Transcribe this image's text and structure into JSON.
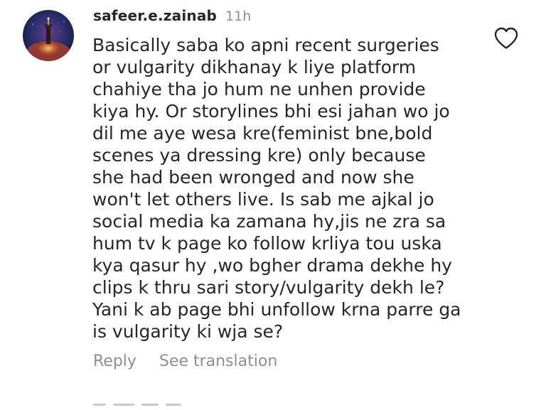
{
  "comment": {
    "username": "safeer.e.zainab",
    "timestamp": "11h",
    "avatar_icon": "profile-photo",
    "text_lines": [
      "Basically saba ko apni recent surgeries",
      "or vulgarity dikhanay k liye platform",
      "chahiye tha jo hum ne unhen provide",
      "kiya hy. Or storylines bhi esi jahan wo jo",
      "dil me aye wesa kre(feminist bne,bold",
      "scenes ya dressing kre) only because",
      "she had been wronged and now she",
      "won't let others live. Is sab me ajkal jo",
      "social media ka zamana hy,jis ne zra sa",
      "hum tv k page ko follow krliya tou uska",
      "kya qasur hy ,wo bgher drama dekhe hy",
      "clips k thru sari story/vulgarity dekh le?",
      "Yani k ab page bhi unfollow krna parre ga",
      "is vulgarity ki wja se?"
    ],
    "like_icon": "heart-outline",
    "actions": {
      "reply": "Reply",
      "see_translation": "See translation"
    }
  },
  "colors": {
    "text": "#262626",
    "secondary": "#8e8e8e",
    "background": "#ffffff"
  }
}
